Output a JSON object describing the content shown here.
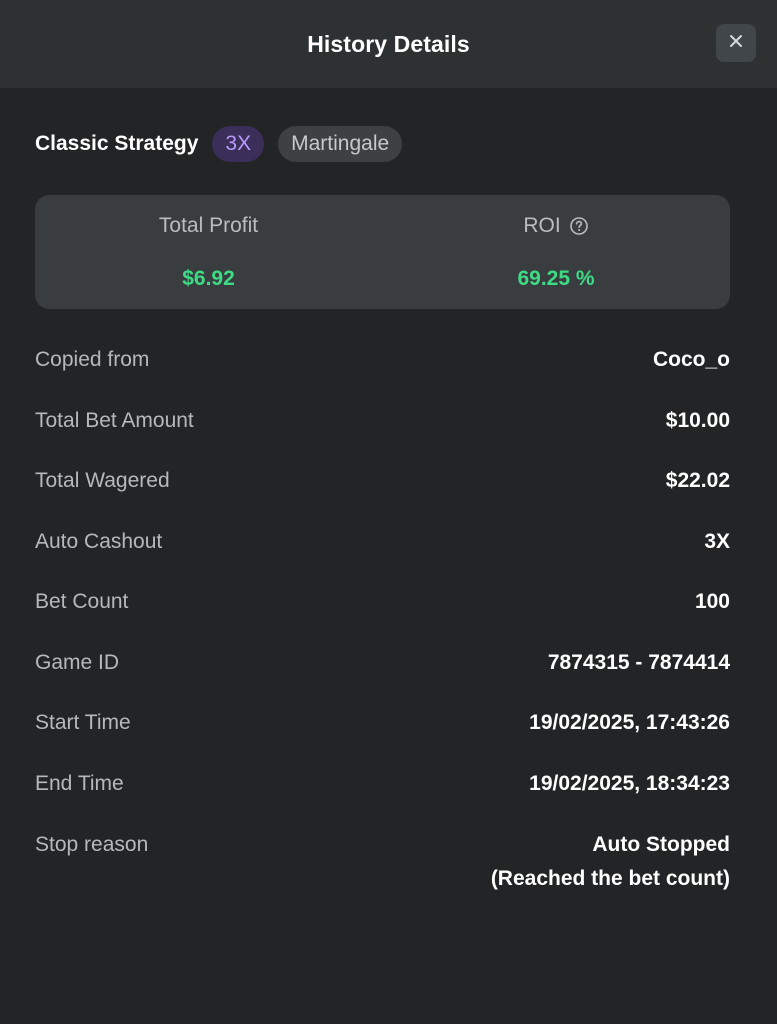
{
  "header": {
    "title": "History Details",
    "close_icon": "close-icon"
  },
  "strategy": {
    "name": "Classic Strategy",
    "multiplier_tag": "3X",
    "mode_tag": "Martingale"
  },
  "stats": {
    "profit_label": "Total Profit",
    "profit_value": "$6.92",
    "roi_label": "ROI",
    "roi_value": "69.25 %",
    "roi_help_icon": "question-circle-icon",
    "value_color": "#3ddc84"
  },
  "details": [
    {
      "label": "Copied from",
      "value": "Coco_o"
    },
    {
      "label": "Total Bet Amount",
      "value": "$10.00"
    },
    {
      "label": "Total Wagered",
      "value": "$22.02"
    },
    {
      "label": "Auto Cashout",
      "value": "3X"
    },
    {
      "label": "Bet Count",
      "value": "100"
    },
    {
      "label": "Game ID",
      "value": "7874315 - 7874414"
    },
    {
      "label": "Start Time",
      "value": "19/02/2025, 17:43:26"
    },
    {
      "label": "End Time",
      "value": "19/02/2025, 18:34:23"
    },
    {
      "label": "Stop reason",
      "value": "Auto Stopped",
      "subvalue": "(Reached the bet count)"
    }
  ]
}
